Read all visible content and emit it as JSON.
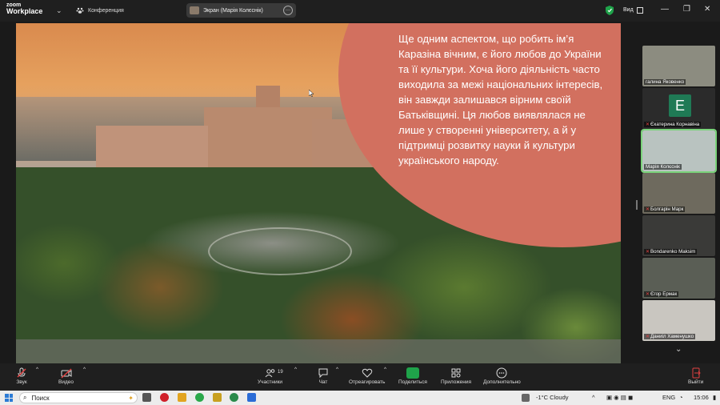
{
  "app": {
    "logo_line1": "zoom",
    "logo_line2": "Workplace"
  },
  "titlebar": {
    "conference_label": "Конференция",
    "screen_tab_label": "Экран (Марія Колєснік)",
    "view_label": "Вид",
    "more_label": "···"
  },
  "slide": {
    "text": "Ще одним аспектом, що робить ім’я Каразіна вічним, є його любов до України та її культури. Хоча його діяльність часто виходила за межі національних інтересів, він завжди залишався вірним своїй Батьківщині. Ця любов виявлялася не лише у створенні університету, а й у підтримці розвитку науки й культури українського народу.",
    "bubble_color": "#d2705f"
  },
  "participants": [
    {
      "name": "галина Яковенко",
      "muted": false,
      "bg": "#8c8c80",
      "active": false
    },
    {
      "name": "Єкатерина Корнавіна",
      "muted": true,
      "bg": "#2b2b2b",
      "avatar": "E",
      "active": false
    },
    {
      "name": "Марія Колєснік",
      "muted": false,
      "bg": "#b9c3c0",
      "active": true
    },
    {
      "name": "Болгарін Марк",
      "muted": true,
      "bg": "#6e6a5e",
      "active": false
    },
    {
      "name": "Bondarenko Maksim",
      "muted": true,
      "bg": "#3a3a38",
      "active": false
    },
    {
      "name": "Єгор Ермак",
      "muted": true,
      "bg": "#5a5e55",
      "active": false
    },
    {
      "name": "Даниіл Хаменушко",
      "muted": true,
      "bg": "#c9c6c0",
      "active": false
    }
  ],
  "toolbar": {
    "audio": "Звук",
    "video": "Видео",
    "participants": "Участники",
    "participants_count": "19",
    "chat": "Чат",
    "react": "Отреагировать",
    "share": "Поделиться",
    "apps": "Приложения",
    "more": "Дополнительно",
    "leave": "Выйти"
  },
  "taskbar": {
    "search_placeholder": "Поиск",
    "weather": "-1°C  Cloudy",
    "lang": "ENG",
    "time": "15:06"
  },
  "colors": {
    "accent_green": "#1fa34a",
    "mute_red": "#e04040",
    "active_outline": "#7ad37a"
  }
}
